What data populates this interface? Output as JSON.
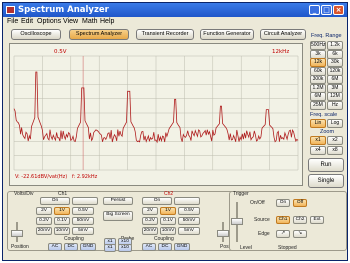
{
  "window": {
    "title": "Spectrum Analyzer"
  },
  "menu": [
    "File",
    "Edit",
    "Options",
    "View",
    "Math",
    "Help"
  ],
  "tabs": [
    "Oscilloscope",
    "Spectrum Analyzer",
    "Transient Recorder",
    "Function Generator",
    "Circuit Analyzer"
  ],
  "active_tab": "Spectrum Analyzer",
  "scope": {
    "top_left": "0.5V",
    "top_right": "12kHz",
    "cursor_readout": "V: -22.61dBV/vat(Hz)",
    "freq_readout": "f: 2.92kHz",
    "colors": {
      "trace": "#b02020",
      "grid": "#bcbcae",
      "cursor": "#d07070",
      "text": "#c00000"
    }
  },
  "chart_data": {
    "type": "line",
    "xlabel": "",
    "ylabel": "",
    "xlim": [
      0,
      12
    ],
    "ylim": [
      0,
      10
    ],
    "grid": true,
    "x_unit": "kHz",
    "series": [
      {
        "peaks": [
          {
            "x": 0.95,
            "y": 8.6
          },
          {
            "x": 2.92,
            "y": 7.2
          },
          {
            "x": 4.85,
            "y": 6.9
          },
          {
            "x": 6.8,
            "y": 6.2
          },
          {
            "x": 8.75,
            "y": 5.6
          },
          {
            "x": 10.7,
            "y": 5.3
          }
        ],
        "noise_floor": 3.0
      }
    ]
  },
  "freq_range": {
    "label": "Freq. Range",
    "buttons": [
      "500Hz",
      "1.2k",
      "3k",
      "6k",
      "12k",
      "30k",
      "60k",
      "120k",
      "300k",
      "6M",
      "1.2M",
      "3M",
      "6M",
      "12M",
      "25M",
      "Hz"
    ],
    "selected": [
      "12k",
      "6k"
    ]
  },
  "freq_scale": {
    "label": "Freq. scale",
    "buttons": [
      "Lin",
      "Log"
    ],
    "selected": "Lin"
  },
  "zoom": {
    "label": "Zoom",
    "buttons": [
      "x1",
      "x2",
      "x4",
      "x8"
    ],
    "selected": "x1"
  },
  "actions": {
    "run": "Run",
    "single": "Single"
  },
  "volts_div": {
    "label": "Volts/Div",
    "ch1": "Ch1",
    "ch2": "Ch2",
    "on": "On",
    "ch1_buttons": [
      "2V",
      "1V",
      "0.5V",
      "0.2V",
      "0.1V",
      "50mV",
      "20mV",
      "10mV",
      "5mV"
    ],
    "ch2_buttons": [
      "2V",
      "1V",
      "0.5V",
      "0.2V",
      "0.1V",
      "50mV",
      "20mV",
      "10mV",
      "5mV"
    ],
    "ch1_selected": "1V",
    "ch2_selected": "1V",
    "persist": "Persist",
    "big_screen": "Big Screen",
    "position": "Position",
    "coupling": "Coupling",
    "coupling_buttons": [
      "AC",
      "DC",
      "GND"
    ],
    "probe": "Probe",
    "probe_buttons": [
      "x1",
      "x10"
    ]
  },
  "trigger": {
    "label": "Trigger",
    "onoff": "On/Off",
    "on": "On",
    "off": "Off",
    "source": "Source",
    "source_buttons": [
      "Ch1",
      "Ch2",
      "Ext"
    ],
    "edge": "Edge",
    "level": "Level",
    "status": "Stopped"
  }
}
